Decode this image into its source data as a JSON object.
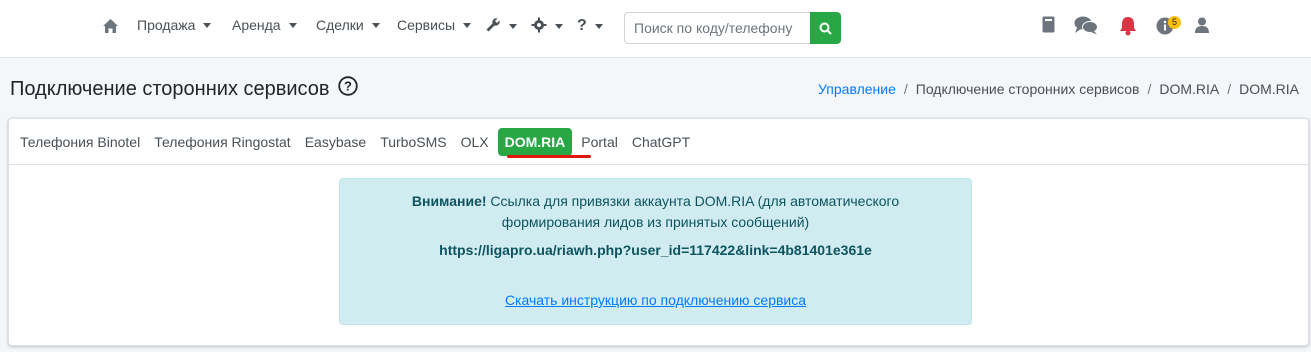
{
  "navbar": {
    "menu": [
      {
        "label": "Продажа"
      },
      {
        "label": "Аренда"
      },
      {
        "label": "Сделки"
      },
      {
        "label": "Сервисы"
      }
    ],
    "search": {
      "placeholder": "Поиск по коду/телефону",
      "value": ""
    },
    "notification_badge": "5"
  },
  "page": {
    "title": "Подключение сторонних сервисов"
  },
  "breadcrumb": {
    "items": [
      "Управление",
      "Подключение сторонних сервисов",
      "DOM.RIA",
      "DOM.RIA"
    ],
    "separator": "/"
  },
  "tabs": {
    "items": [
      "Телефония Binotel",
      "Телефония Ringostat",
      "Easybase",
      "TurboSMS",
      "OLX",
      "DOM.RIA",
      "Portal",
      "ChatGPT"
    ],
    "active": "DOM.RIA"
  },
  "alert": {
    "strong": "Внимание!",
    "text": " Ссылка для привязки аккаунта DOM.RIA (для автоматического формирования лидов из принятых сообщений)",
    "url": "https://ligapro.ua/riawh.php?user_id=117422&link=4b81401e361e",
    "download_link": "Скачать инструкцию по подключению сервиса"
  },
  "colors": {
    "accent_green": "#28a745",
    "link_blue": "#007bff",
    "alert_bg": "#d1ecf1",
    "bell_red": "#dc3545",
    "underline_red": "#e3160b"
  }
}
